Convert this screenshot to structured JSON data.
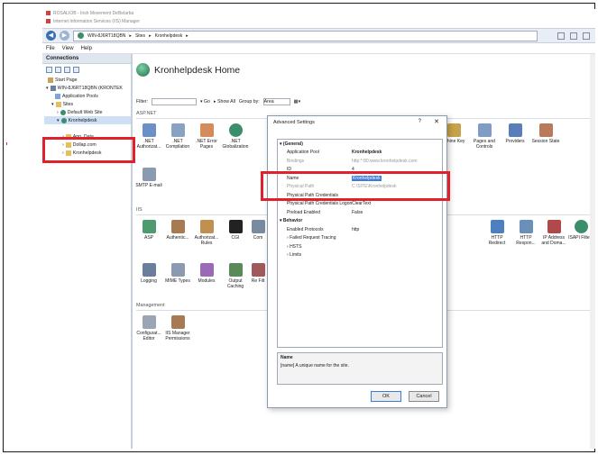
{
  "window": {
    "title_line1": "ROSALIOB - Irish Movement DeBelarba",
    "title_line2": "Internet Information Services (IIS) Manager"
  },
  "address": {
    "path": [
      "WIN-8J6RT18QBN",
      "Sites",
      "Kronhelpdesk"
    ]
  },
  "menu": [
    "File",
    "View",
    "Help"
  ],
  "connections": {
    "header": "Connections",
    "tree": [
      {
        "label": "Start Page",
        "icon": "home"
      },
      {
        "label": "WIN-8J6RT18QBN (KRONTEK",
        "icon": "server"
      },
      {
        "label": "Application Pools",
        "icon": "pool"
      },
      {
        "label": "Sites",
        "icon": "folder"
      },
      {
        "label": "Default Web Site",
        "icon": "globe"
      },
      {
        "label": "Kronhelpdesk",
        "icon": "globe"
      },
      {
        "label": "",
        "icon": ""
      },
      {
        "label": "App_Data",
        "icon": "folder"
      },
      {
        "label": "Dollap.com",
        "icon": "folder"
      },
      {
        "label": "Kronhelpdesk",
        "icon": "folder"
      }
    ]
  },
  "main": {
    "title": "Kronhelpdesk Home",
    "filter_label": "Filter:",
    "go": "Go",
    "show_all": "Show All",
    "group_by_label": "Group by:",
    "group_by_value": "Area",
    "sections": {
      "aspnet": "ASP.NET",
      "iis": "IIS",
      "management": "Management"
    },
    "aspnet_icons": [
      ".NET Authorizat...",
      ".NET Compilation",
      ".NET Error Pages",
      ".NET Globalization"
    ],
    "aspnet_icons_right": [
      "achine Key",
      "Pages and Controls",
      "Providers",
      "Session State"
    ],
    "smtp": "SMTP E-mail",
    "iis_icons": [
      "ASP",
      "Authentic...",
      "Authorizat... Rules",
      "CGI",
      "Com"
    ],
    "iis_icons_right": [
      "HTTP Redirect",
      "HTTP Respon...",
      "IP Address and Doma...",
      "ISAPI Filters"
    ],
    "iis_icons_row2": [
      "Logging",
      "MIME Types",
      "Modules",
      "Output Caching",
      "Re Filt"
    ],
    "management_icons": [
      "Configurat... Editor",
      "IIS Manager Permissions"
    ]
  },
  "dialog": {
    "title": "Advanced Settings",
    "help": "?",
    "close": "✕",
    "rows": [
      {
        "k": "(General)",
        "v": "",
        "cat": true
      },
      {
        "k": "Application Pool",
        "v": "Kronhelpdesk"
      },
      {
        "k": "Bindings",
        "v": "http:*:80:www.kronhelpdesk.com",
        "dim": true
      },
      {
        "k": "ID",
        "v": "4"
      },
      {
        "k": "Name",
        "v": "Kronhelpdesk",
        "sel": true
      },
      {
        "k": "Physical Path",
        "v": "C:\\SITE\\Kronhelpdesk",
        "dim": true
      },
      {
        "k": "Physical Path Credentials",
        "v": ""
      },
      {
        "k": "Physical Path Credentials Logon",
        "v": "ClearText"
      },
      {
        "k": "Preload Enabled",
        "v": "False"
      },
      {
        "k": "Behavior",
        "v": "",
        "cat": true
      },
      {
        "k": "Enabled Protocols",
        "v": "http"
      },
      {
        "k": "Failed Request Tracing",
        "v": ""
      },
      {
        "k": "HSTS",
        "v": ""
      },
      {
        "k": "Limits",
        "v": ""
      }
    ],
    "desc_name": "Name",
    "desc_text": "[name] A unique name for the site.",
    "ok": "OK",
    "cancel": "Cancel"
  },
  "colors": {
    "highlight": "#e0202a",
    "selection": "#3a7bd5"
  }
}
